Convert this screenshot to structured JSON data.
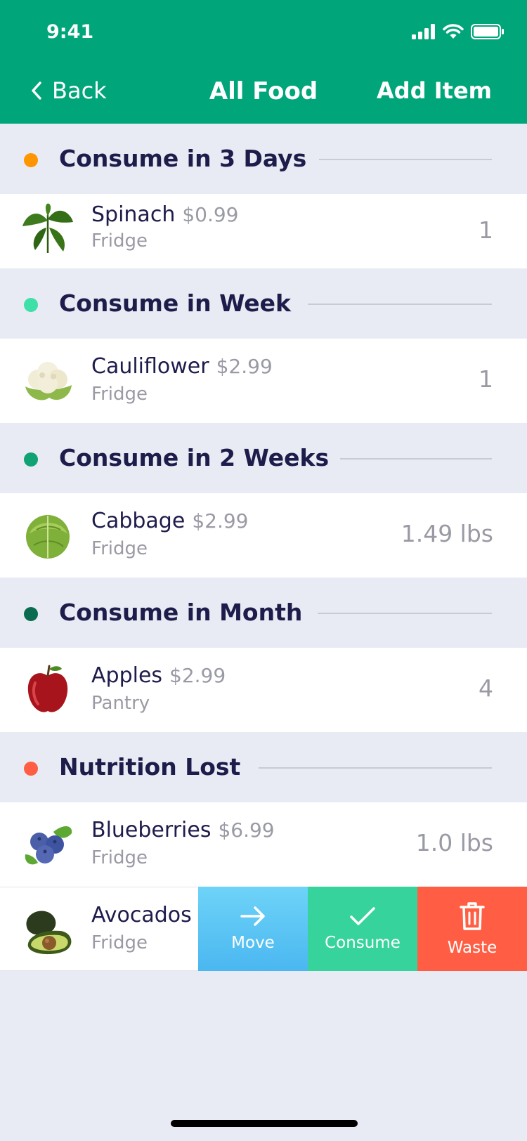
{
  "status_bar": {
    "time": "9:41"
  },
  "nav": {
    "back_label": "Back",
    "title": "All Food",
    "add_label": "Add Item"
  },
  "sections": [
    {
      "title": "Consume in 3 Days",
      "dot_color": "#FF9500",
      "items": [
        {
          "name": "Spinach",
          "price": "$0.99",
          "location": "Fridge",
          "quantity": "1",
          "icon": "spinach-image"
        }
      ]
    },
    {
      "title": "Consume in Week",
      "dot_color": "#3EE0A8",
      "items": [
        {
          "name": "Cauliflower",
          "price": "$2.99",
          "location": "Fridge",
          "quantity": "1",
          "icon": "cauliflower-image"
        }
      ]
    },
    {
      "title": "Consume in 2 Weeks",
      "dot_color": "#10A273",
      "items": [
        {
          "name": "Cabbage",
          "price": "$2.99",
          "location": "Fridge",
          "quantity": "1.49 lbs",
          "icon": "cabbage-image"
        }
      ]
    },
    {
      "title": "Consume in Month",
      "dot_color": "#0B6B50",
      "items": [
        {
          "name": "Apples",
          "price": "$2.99",
          "location": "Pantry",
          "quantity": "4",
          "icon": "apple-image"
        }
      ]
    },
    {
      "title": "Nutrition Lost",
      "dot_color": "#FF5E44",
      "items": [
        {
          "name": "Blueberries",
          "price": "$6.99",
          "location": "Fridge",
          "quantity": "1.0 lbs",
          "icon": "blueberries-image"
        },
        {
          "name": "Avocados",
          "location": "Fridge",
          "icon": "avocado-image"
        }
      ]
    }
  ],
  "swipe_actions": [
    {
      "label": "Move",
      "icon": "arrow-right-icon",
      "color": "#4AB7F0"
    },
    {
      "label": "Consume",
      "icon": "check-icon",
      "color": "#36D39C"
    },
    {
      "label": "Waste",
      "icon": "trash-icon",
      "color": "#FF5E44"
    }
  ]
}
